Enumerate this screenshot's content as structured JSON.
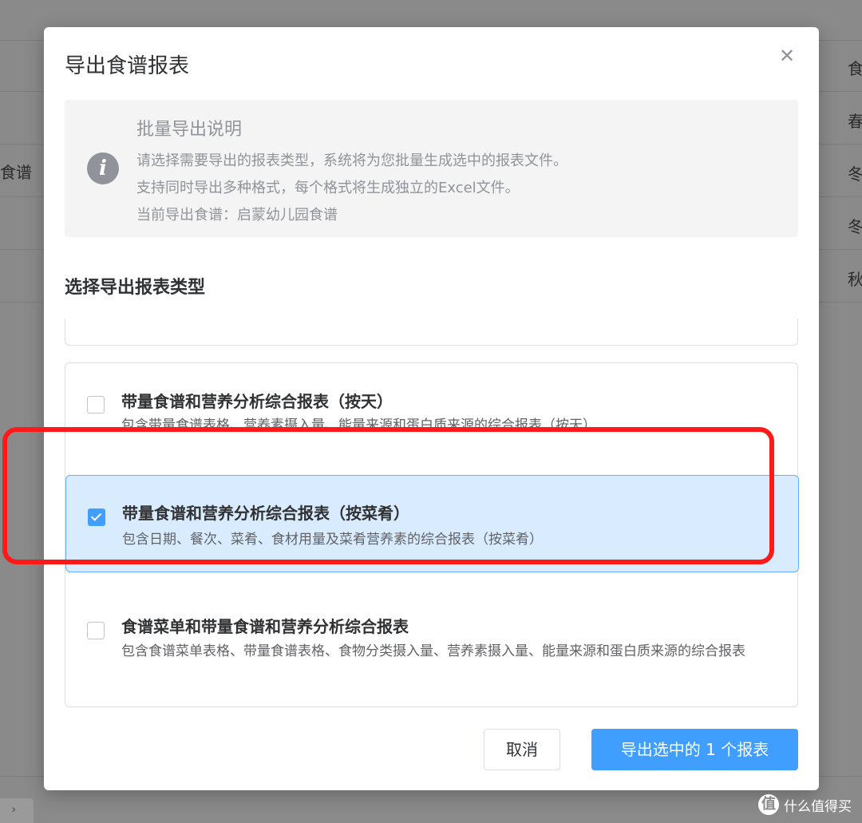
{
  "background": {
    "left_text": "食谱",
    "right_column": [
      "食",
      "春",
      "冬",
      "冬",
      "秋"
    ],
    "pager_arrow": "›"
  },
  "dialog": {
    "title": "导出食谱报表",
    "close_icon": "close-icon",
    "info": {
      "icon": "info-icon",
      "icon_glyph": "i",
      "title": "批量导出说明",
      "lines": [
        "请选择需要导出的报表类型，系统将为您批量生成选中的报表文件。",
        "支持同时导出多种格式，每个格式将生成独立的Excel文件。",
        "当前导出食谱：启蒙幼儿园食谱"
      ]
    },
    "section_title": "选择导出报表类型",
    "options": [
      {
        "title": "带量食谱和营养分析综合报表（按天）",
        "desc": "包含带量食谱表格、营养素摄入量、能量来源和蛋白质来源的综合报表（按天）",
        "checked": false
      },
      {
        "title": "带量食谱和营养分析综合报表（按菜肴）",
        "desc": "包含日期、餐次、菜肴、食材用量及菜肴营养素的综合报表（按菜肴）",
        "checked": true
      },
      {
        "title": "食谱菜单和带量食谱和营养分析综合报表",
        "desc": "包含食谱菜单表格、带量食谱表格、食物分类摄入量、营养素摄入量、能量来源和蛋白质来源的综合报表",
        "checked": false
      }
    ],
    "buttons": {
      "cancel": "取消",
      "export": "导出选中的 1 个报表"
    }
  },
  "watermark": {
    "logo": "值",
    "text": "什么值得买"
  },
  "colors": {
    "primary": "#409eff",
    "selected_bg": "#d9ecff",
    "highlight_ring": "#ff1a1a",
    "overlay": "#8a8a8a"
  }
}
